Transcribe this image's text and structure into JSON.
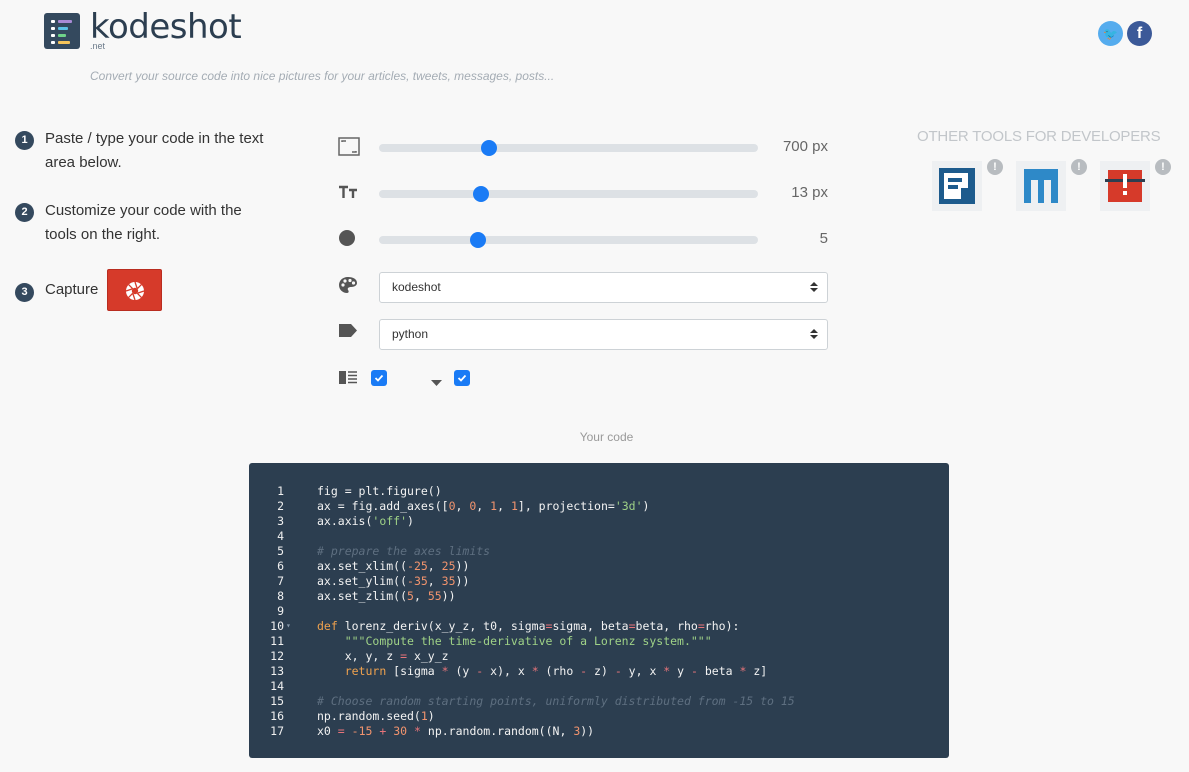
{
  "brand": {
    "name": "kodeshot",
    "tld": ".net",
    "tagline": "Convert your source code into nice pictures for your articles, tweets, messages, posts..."
  },
  "social": {
    "twitter_icon": "twitter-icon",
    "facebook_icon": "facebook-icon",
    "twitter_glyph": "🐦",
    "facebook_glyph": "f"
  },
  "steps": [
    {
      "num": "1",
      "text": "Paste / type your code in the text area below."
    },
    {
      "num": "2",
      "text": "Customize your code with the tools on the right."
    },
    {
      "num": "3",
      "text": "Capture"
    }
  ],
  "controls": {
    "width": {
      "value": 700,
      "label": "700 px",
      "fraction": 0.29
    },
    "font_size": {
      "value": 13,
      "label": "13 px",
      "fraction": 0.27
    },
    "radius": {
      "value": 5,
      "label": "5",
      "fraction": 0.26
    },
    "theme": {
      "selected": "kodeshot"
    },
    "language": {
      "selected": "python"
    },
    "line_numbers_checked": true,
    "folding_checked": true
  },
  "other_tools": {
    "title": "OTHER TOOLS FOR DEVELOPERS",
    "info_glyph": "!"
  },
  "code_section": {
    "label": "Your code",
    "lines": [
      {
        "n": "1",
        "fold": ""
      },
      {
        "n": "2",
        "fold": ""
      },
      {
        "n": "3",
        "fold": ""
      },
      {
        "n": "4",
        "fold": ""
      },
      {
        "n": "5",
        "fold": ""
      },
      {
        "n": "6",
        "fold": ""
      },
      {
        "n": "7",
        "fold": ""
      },
      {
        "n": "8",
        "fold": ""
      },
      {
        "n": "9",
        "fold": ""
      },
      {
        "n": "10",
        "fold": "▾"
      },
      {
        "n": "11",
        "fold": ""
      },
      {
        "n": "12",
        "fold": ""
      },
      {
        "n": "13",
        "fold": ""
      },
      {
        "n": "14",
        "fold": ""
      },
      {
        "n": "15",
        "fold": ""
      },
      {
        "n": "16",
        "fold": ""
      },
      {
        "n": "17",
        "fold": ""
      }
    ],
    "code": [
      [
        [
          "fig = plt.figure()",
          ""
        ]
      ],
      [
        [
          "ax = fig.add_axes([",
          ""
        ],
        [
          "0",
          "num"
        ],
        [
          ", ",
          ""
        ],
        [
          "0",
          "num"
        ],
        [
          ", ",
          ""
        ],
        [
          "1",
          "num"
        ],
        [
          ", ",
          ""
        ],
        [
          "1",
          "num"
        ],
        [
          "], projection=",
          ""
        ],
        [
          "'3d'",
          "str"
        ],
        [
          ")",
          ""
        ]
      ],
      [
        [
          "ax.axis(",
          ""
        ],
        [
          "'off'",
          "str"
        ],
        [
          ")",
          ""
        ]
      ],
      [],
      [
        [
          "# prepare the axes limits",
          "com"
        ]
      ],
      [
        [
          "ax.set_xlim((",
          ""
        ],
        [
          "-25",
          "num"
        ],
        [
          ", ",
          ""
        ],
        [
          "25",
          "num"
        ],
        [
          "))",
          ""
        ]
      ],
      [
        [
          "ax.set_ylim((",
          ""
        ],
        [
          "-35",
          "num"
        ],
        [
          ", ",
          ""
        ],
        [
          "35",
          "num"
        ],
        [
          "))",
          ""
        ]
      ],
      [
        [
          "ax.set_zlim((",
          ""
        ],
        [
          "5",
          "num"
        ],
        [
          ", ",
          ""
        ],
        [
          "55",
          "num"
        ],
        [
          "))",
          ""
        ]
      ],
      [],
      [
        [
          "def",
          "kw"
        ],
        [
          " lorenz_deriv(x_y_z, t0, sigma",
          ""
        ],
        [
          "=",
          "op"
        ],
        [
          "sigma, beta",
          ""
        ],
        [
          "=",
          "op"
        ],
        [
          "beta, rho",
          ""
        ],
        [
          "=",
          "op"
        ],
        [
          "rho):",
          ""
        ]
      ],
      [
        [
          "    ",
          ""
        ],
        [
          "\"\"\"Compute the time-derivative of a Lorenz system.\"\"\"",
          "str"
        ]
      ],
      [
        [
          "    x, y, z ",
          ""
        ],
        [
          "=",
          "op"
        ],
        [
          " x_y_z",
          ""
        ]
      ],
      [
        [
          "    ",
          ""
        ],
        [
          "return",
          "kw"
        ],
        [
          " [sigma ",
          ""
        ],
        [
          "*",
          "op"
        ],
        [
          " (y ",
          ""
        ],
        [
          "-",
          "op"
        ],
        [
          " x), x ",
          ""
        ],
        [
          "*",
          "op"
        ],
        [
          " (rho ",
          ""
        ],
        [
          "-",
          "op"
        ],
        [
          " z) ",
          ""
        ],
        [
          "-",
          "op"
        ],
        [
          " y, x ",
          ""
        ],
        [
          "*",
          "op"
        ],
        [
          " y ",
          ""
        ],
        [
          "-",
          "op"
        ],
        [
          " beta ",
          ""
        ],
        [
          "*",
          "op"
        ],
        [
          " z]",
          ""
        ]
      ],
      [],
      [
        [
          "# Choose random starting points, uniformly distributed from -15 to 15",
          "com"
        ]
      ],
      [
        [
          "np.random.seed(",
          ""
        ],
        [
          "1",
          "num"
        ],
        [
          ")",
          ""
        ]
      ],
      [
        [
          "x0 ",
          ""
        ],
        [
          "=",
          "op"
        ],
        [
          " ",
          ""
        ],
        [
          "-15",
          "num"
        ],
        [
          " ",
          ""
        ],
        [
          "+",
          "op"
        ],
        [
          " ",
          ""
        ],
        [
          "30",
          "num"
        ],
        [
          " ",
          ""
        ],
        [
          "*",
          "op"
        ],
        [
          " np.random.random((N, ",
          ""
        ],
        [
          "3",
          "num"
        ],
        [
          "))",
          ""
        ]
      ]
    ]
  }
}
